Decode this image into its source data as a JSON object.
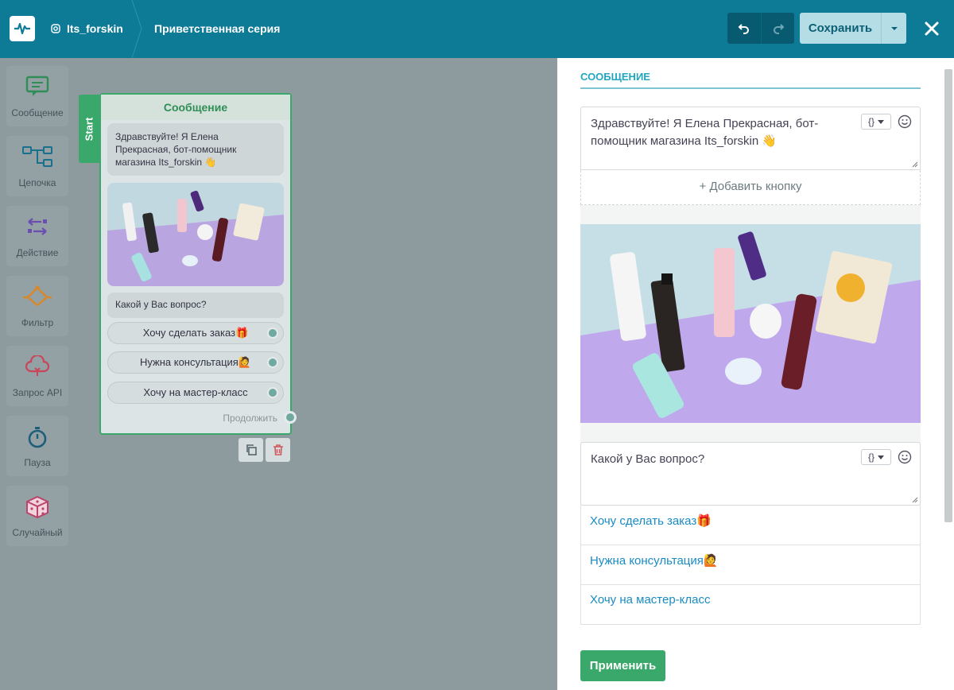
{
  "header": {
    "account": "Its_forskin",
    "flow_name": "Приветственная серия",
    "save_label": "Сохранить"
  },
  "toolbar": {
    "items": [
      {
        "label": "Сообщение",
        "icon": "message-icon",
        "color": "#2f8e55"
      },
      {
        "label": "Цепочка",
        "icon": "chain-icon",
        "color": "#1a6f8c"
      },
      {
        "label": "Действие",
        "icon": "action-icon",
        "color": "#6a4fb0"
      },
      {
        "label": "Фильтр",
        "icon": "filter-icon",
        "color": "#d8872a"
      },
      {
        "label": "Запрос API",
        "icon": "api-cloud-icon",
        "color": "#c9455a"
      },
      {
        "label": "Пауза",
        "icon": "stopwatch-icon",
        "color": "#1b5f78"
      },
      {
        "label": "Случайный",
        "icon": "dice-icon",
        "color": "#b9456c"
      }
    ]
  },
  "node": {
    "start_label": "Start",
    "title": "Сообщение",
    "message": "Здравствуйте! Я Елена Прекрасная, бот-помощник магазина Its_forskin 👋",
    "question": "Какой у Вас вопрос?",
    "buttons": [
      "Хочу сделать заказ🎁",
      "Нужна консультация🙋",
      "Хочу на мастер-класс"
    ],
    "continue_label": "Продолжить"
  },
  "panel": {
    "section_title": "СООБЩЕНИЕ",
    "message_text": "Здравствуйте! Я Елена Прекрасная, бот-помощник магазина Its_forskin 👋",
    "add_button_label": "+ Добавить кнопку",
    "question_text": "Какой у Вас вопрос?",
    "buttons": [
      "Хочу сделать заказ🎁",
      "Нужна консультация🙋",
      "Хочу на мастер-класс"
    ],
    "apply_label": "Применить",
    "var_label": "{}"
  },
  "colors": {
    "header": "#0d7a96",
    "accent_green": "#3aa86a",
    "link_blue": "#1a8bc4",
    "section_title": "#22a6bd"
  }
}
